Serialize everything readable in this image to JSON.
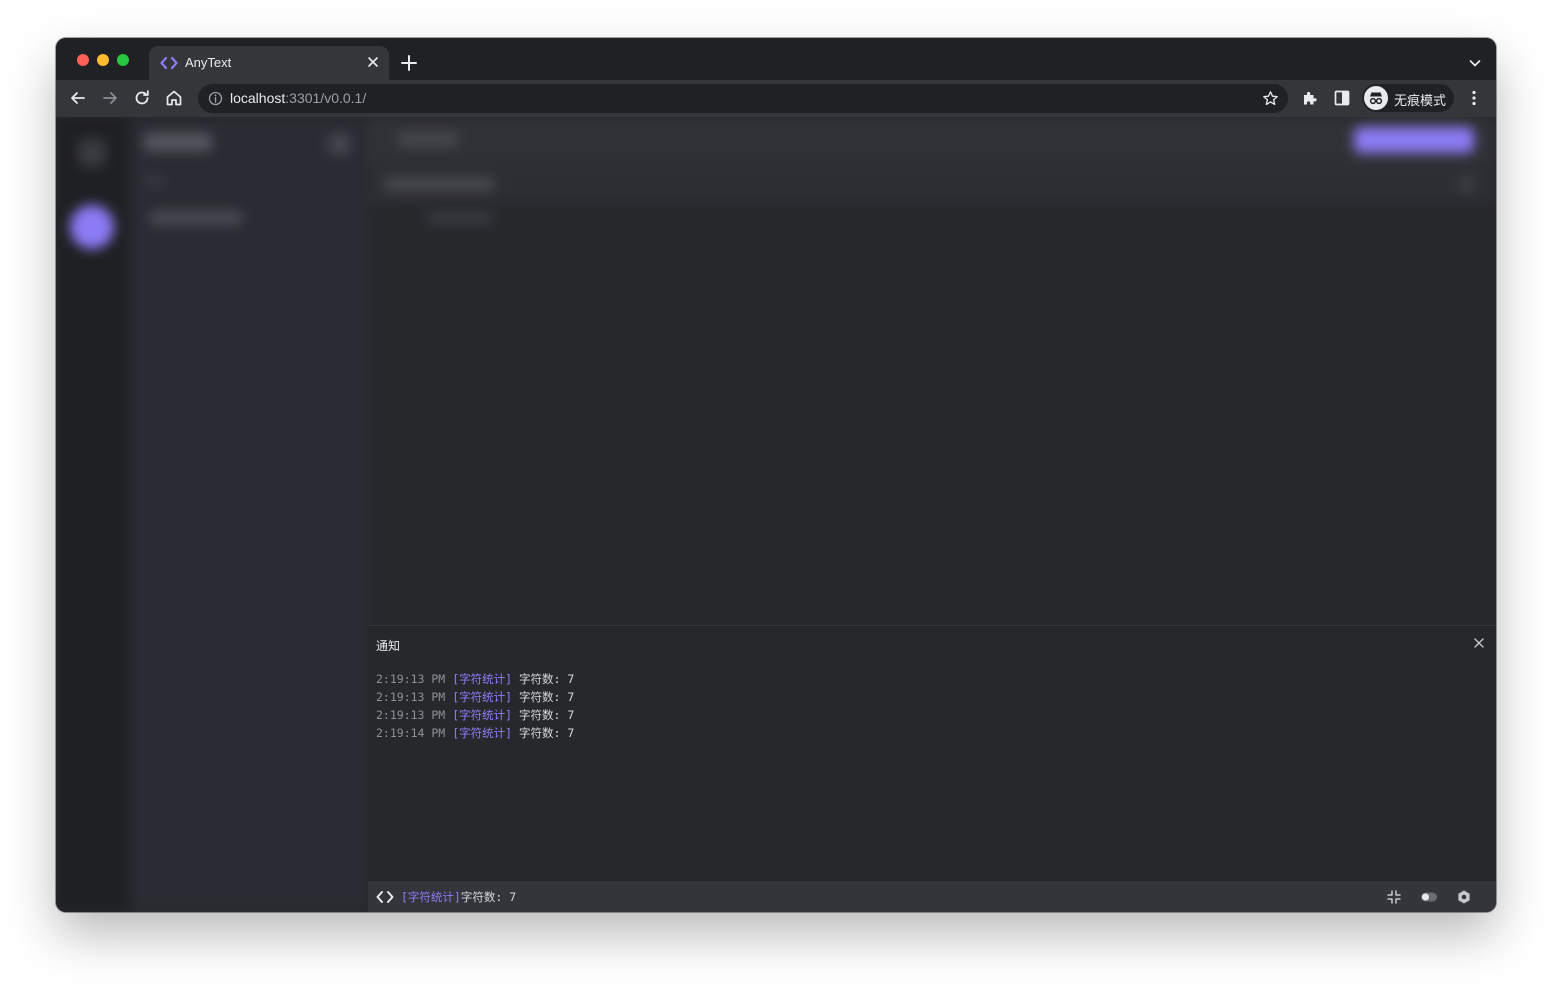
{
  "browser": {
    "tab_title": "AnyText",
    "url_host": "localhost",
    "url_rest": ":3301/v0.0.1/",
    "profile_label": "无痕模式"
  },
  "notifications": {
    "title": "通知",
    "entries": [
      {
        "time": "2:19:13 PM",
        "tag": "[字符统计]",
        "message": "字符数: 7"
      },
      {
        "time": "2:19:13 PM",
        "tag": "[字符统计]",
        "message": "字符数: 7"
      },
      {
        "time": "2:19:13 PM",
        "tag": "[字符统计]",
        "message": "字符数: 7"
      },
      {
        "time": "2:19:14 PM",
        "tag": "[字符统计]",
        "message": "字符数: 7"
      }
    ]
  },
  "status_bar": {
    "tag": "[字符统计]",
    "message": "字符数: 7"
  },
  "colors": {
    "accent": "#8f7cf8",
    "background": "#27282c",
    "chrome_frame": "#202124",
    "chrome_toolbar": "#35363a"
  },
  "icons": {
    "app": "code-brackets-icon",
    "status_right": [
      "collapse-icon",
      "toggle-icon",
      "settings-icon"
    ]
  }
}
